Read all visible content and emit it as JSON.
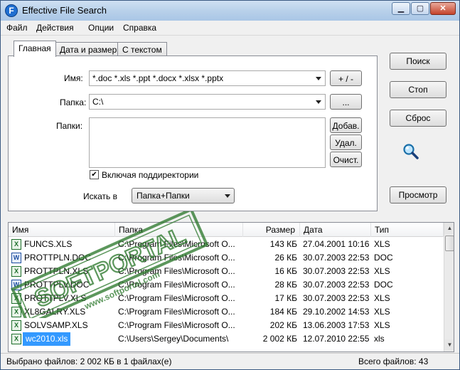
{
  "window": {
    "title": "Effective File Search",
    "app_icon_letter": "F"
  },
  "menu": [
    {
      "label": "Файл"
    },
    {
      "label": "Действия"
    },
    {
      "label": "Опции"
    },
    {
      "label": "Справка"
    }
  ],
  "tabs": [
    {
      "label": "Главная",
      "active": true
    },
    {
      "label": "Дата и размер",
      "active": false
    },
    {
      "label": "С текстом",
      "active": false
    }
  ],
  "form": {
    "name_label": "Имя:",
    "name_value": "*.doc *.xls *.ppt *.docx *.xlsx *.pptx",
    "plusminus_label": "+ / -",
    "folder_label": "Папка:",
    "folder_value": "C:\\",
    "browse_label": "...",
    "folders_label": "Папки:",
    "add_label": "Добав.",
    "remove_label": "Удал.",
    "clear_label": "Очист.",
    "subdirs_label": "Включая поддиректории",
    "subdirs_checked": true,
    "search_in_label": "Искать в",
    "search_in_value": "Папка+Папки"
  },
  "side_buttons": {
    "search": "Поиск",
    "stop": "Стоп",
    "reset": "Сброс",
    "preview": "Просмотр"
  },
  "results": {
    "columns": [
      "Имя",
      "Папка",
      "Размер",
      "Дата",
      "Тип"
    ],
    "rows": [
      {
        "name": "FUNCS.XLS",
        "folder": "C:\\Program Files\\Microsoft O...",
        "size": "143 КБ",
        "date": "27.04.2001 10:16",
        "type": "XLS",
        "icon": "xls"
      },
      {
        "name": "PROTTPLN.DOC",
        "folder": "C:\\Program Files\\Microsoft O...",
        "size": "26 КБ",
        "date": "30.07.2003 22:53",
        "type": "DOC",
        "icon": "doc"
      },
      {
        "name": "PROTTPLN.XLS",
        "folder": "C:\\Program Files\\Microsoft O...",
        "size": "16 КБ",
        "date": "30.07.2003 22:53",
        "type": "XLS",
        "icon": "xls"
      },
      {
        "name": "PROTTPLV.DOC",
        "folder": "C:\\Program Files\\Microsoft O...",
        "size": "28 КБ",
        "date": "30.07.2003 22:53",
        "type": "DOC",
        "icon": "doc"
      },
      {
        "name": "PROTTPLV.XLS",
        "folder": "C:\\Program Files\\Microsoft O...",
        "size": "17 КБ",
        "date": "30.07.2003 22:53",
        "type": "XLS",
        "icon": "xls"
      },
      {
        "name": "XL8GALRY.XLS",
        "folder": "C:\\Program Files\\Microsoft O...",
        "size": "184 КБ",
        "date": "29.10.2002 14:53",
        "type": "XLS",
        "icon": "xls"
      },
      {
        "name": "SOLVSAMP.XLS",
        "folder": "C:\\Program Files\\Microsoft O...",
        "size": "202 КБ",
        "date": "13.06.2003 17:53",
        "type": "XLS",
        "icon": "xls"
      },
      {
        "name": "wc2010.xls",
        "folder": "C:\\Users\\Sergey\\Documents\\",
        "size": "2 002 КБ",
        "date": "12.07.2010 22:55",
        "type": "xls",
        "icon": "xls",
        "selected": true
      }
    ]
  },
  "status": {
    "left": "Выбрано файлов: 2 002 КБ в 1 файлах(е)",
    "right": "Всего файлов: 43"
  },
  "watermark": {
    "text": "SOFTPORTAL",
    "tm": "TM",
    "url": "www.softportal.com"
  },
  "colors": {
    "selection": "#3399ff",
    "title_gradient_top": "#cfe0f2",
    "stamp": "#2f7a2f"
  }
}
